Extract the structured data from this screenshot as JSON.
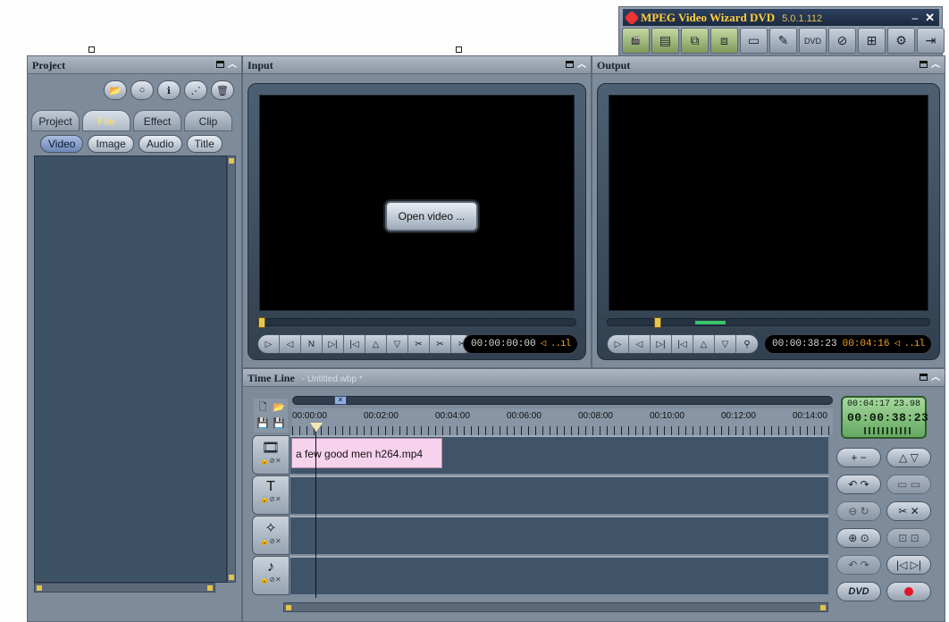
{
  "app": {
    "title": "MPEG Video Wizard DVD",
    "version": "5.0.1.112",
    "minimize": "–",
    "close": "✕",
    "toolbar": [
      {
        "icon": "project-open-icon",
        "glyph": "🎬"
      },
      {
        "icon": "film-strip-icon",
        "glyph": "▤"
      },
      {
        "icon": "encode-icon",
        "glyph": "⧉"
      },
      {
        "icon": "convert-icon",
        "glyph": "⧈"
      },
      {
        "icon": "tape-icon",
        "glyph": "▭"
      },
      {
        "icon": "edit-icon",
        "glyph": "✎"
      },
      {
        "icon": "dvd-icon",
        "glyph": "DVD"
      },
      {
        "icon": "no-disc-icon",
        "glyph": "⊘"
      },
      {
        "icon": "layout-icon",
        "glyph": "⊞"
      },
      {
        "icon": "tools-icon",
        "glyph": "⚙"
      },
      {
        "icon": "exit-icon",
        "glyph": "⇥"
      }
    ]
  },
  "project": {
    "header": "Project",
    "tools": [
      {
        "icon": "open-folder-icon",
        "glyph": "📂"
      },
      {
        "icon": "disk-icon",
        "glyph": "○"
      },
      {
        "icon": "info-icon",
        "glyph": "ℹ"
      },
      {
        "icon": "tree-icon",
        "glyph": "⋰"
      },
      {
        "icon": "trash-icon",
        "glyph": "🗑"
      }
    ],
    "tabs": [
      "Project",
      "File",
      "Effect",
      "Clip"
    ],
    "active_tab": "File",
    "subtabs": [
      "Video",
      "Image",
      "Audio",
      "Title"
    ],
    "active_subtab": "Video"
  },
  "input": {
    "header": "Input",
    "open_button": "Open video ...",
    "time": "00:00:00:00",
    "volume": "◁ ..ıl"
  },
  "output": {
    "header": "Output",
    "time": "00:00:38:23",
    "duration": "00:04:16",
    "volume": "◁ ..ıl"
  },
  "transport_in": [
    "▷",
    "◁",
    "N",
    "▷|",
    "|◁",
    "△",
    "▽",
    "✂",
    "✂",
    "✂"
  ],
  "transport_out": [
    "▷",
    "◁",
    "▷|",
    "|◁",
    "△",
    "▽",
    "⚲"
  ],
  "timeline": {
    "header": "Time Line",
    "file": "- Untitled.wbp *",
    "ruler": [
      "00:00:00",
      "00:02:00",
      "00:04:00",
      "00:06:00",
      "00:08:00",
      "00:10:00",
      "00:12:00",
      "00:14:00"
    ],
    "tools": [
      "🗋",
      "📂",
      "💾",
      "💾"
    ],
    "tracks": [
      {
        "icon": "video-track-icon",
        "glyph": "🎞"
      },
      {
        "icon": "title-track-icon",
        "glyph": "T"
      },
      {
        "icon": "effect-track-icon",
        "glyph": "✧"
      },
      {
        "icon": "audio-track-icon",
        "glyph": "♪"
      }
    ],
    "clip_name": "a few good men h264.mp4",
    "lcd": {
      "duration": "00:04:17",
      "fps": "23.98",
      "position": "00:00:38:23"
    },
    "right_buttons": [
      {
        "label": "+ −",
        "dim": false
      },
      {
        "label": "△ ▽",
        "dim": false
      },
      {
        "label": "↶ ↷",
        "dim": false
      },
      {
        "label": "▭ ▭",
        "dim": true
      },
      {
        "label": "⊖ ↻",
        "dim": true
      },
      {
        "label": "✂ ✕",
        "dim": false
      },
      {
        "label": "⊕ ⊙",
        "dim": false
      },
      {
        "label": "⊡ ⊡",
        "dim": true
      },
      {
        "label": "↶ ↷",
        "dim": true
      },
      {
        "label": "|◁ ▷|",
        "dim": false
      }
    ],
    "dvd_button": "DVD"
  }
}
